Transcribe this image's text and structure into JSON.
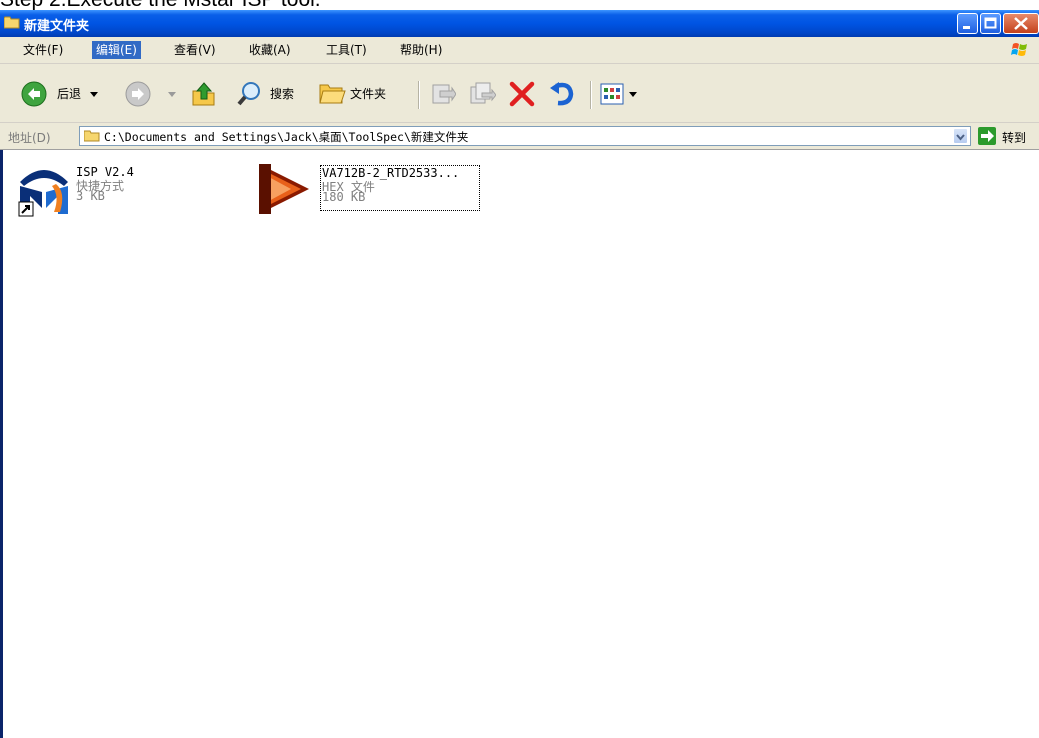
{
  "caption": "Step 2.Execute the Mstar ISP tool.",
  "window": {
    "title": "新建文件夹"
  },
  "menu": [
    {
      "label": "文件(F)"
    },
    {
      "label": "编辑(E)"
    },
    {
      "label": "查看(V)"
    },
    {
      "label": "收藏(A)"
    },
    {
      "label": "工具(T)"
    },
    {
      "label": "帮助(H)"
    }
  ],
  "menu_active_index": 1,
  "toolbar": {
    "back_label": "后退",
    "search_label": "搜索",
    "folders_label": "文件夹"
  },
  "address": {
    "label": "地址(D)",
    "path": "C:\\Documents and Settings\\Jack\\桌面\\ToolSpec\\新建文件夹",
    "go_label": "转到"
  },
  "files": [
    {
      "name": "ISP V2.4",
      "type": "快捷方式",
      "size": "3 KB",
      "icon": "mstar-isp-shortcut-icon"
    },
    {
      "name": "VA712B-2_RTD2533...",
      "type": "HEX 文件",
      "size": "180 KB",
      "icon": "hex-file-icon"
    }
  ],
  "colors": {
    "titlebar": "#0054e3",
    "chrome": "#ece9d8",
    "selection": "#316ac5"
  }
}
